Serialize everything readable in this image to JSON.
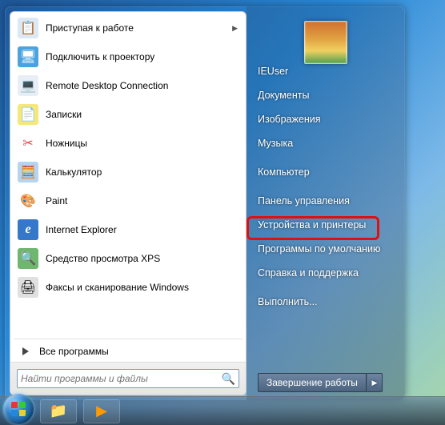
{
  "programs": [
    {
      "label": "Приступая к работе",
      "icon": "📋",
      "bg": "#dce9f5",
      "has_submenu": true
    },
    {
      "label": "Подключить к проектору",
      "icon": "🖥",
      "bg": "#4aa3df"
    },
    {
      "label": "Remote Desktop Connection",
      "icon": "💻",
      "bg": "#e8eef5"
    },
    {
      "label": "Записки",
      "icon": "📄",
      "bg": "#f5e77a"
    },
    {
      "label": "Ножницы",
      "icon": "✂",
      "bg": "#e88"
    },
    {
      "label": "Калькулятор",
      "icon": "🧮",
      "bg": "#b6d4ef"
    },
    {
      "label": "Paint",
      "icon": "🎨",
      "bg": "#fff"
    },
    {
      "label": "Internet Explorer",
      "icon": "e",
      "bg": "#3578c9"
    },
    {
      "label": "Средство просмотра XPS",
      "icon": "🔍",
      "bg": "#6fb66f"
    },
    {
      "label": "Факсы и сканирование Windows",
      "icon": "🖨",
      "bg": "#e0e0e0"
    }
  ],
  "all_programs_label": "Все программы",
  "search": {
    "placeholder": "Найти программы и файлы"
  },
  "right_items": {
    "user": "IEUser",
    "documents": "Документы",
    "pictures": "Изображения",
    "music": "Музыка",
    "computer": "Компьютер",
    "control_panel": "Панель управления",
    "devices": "Устройства и принтеры",
    "default_programs": "Программы по умолчанию",
    "help": "Справка и поддержка",
    "run": "Выполнить..."
  },
  "shutdown_label": "Завершение работы",
  "highlighted": "control_panel"
}
